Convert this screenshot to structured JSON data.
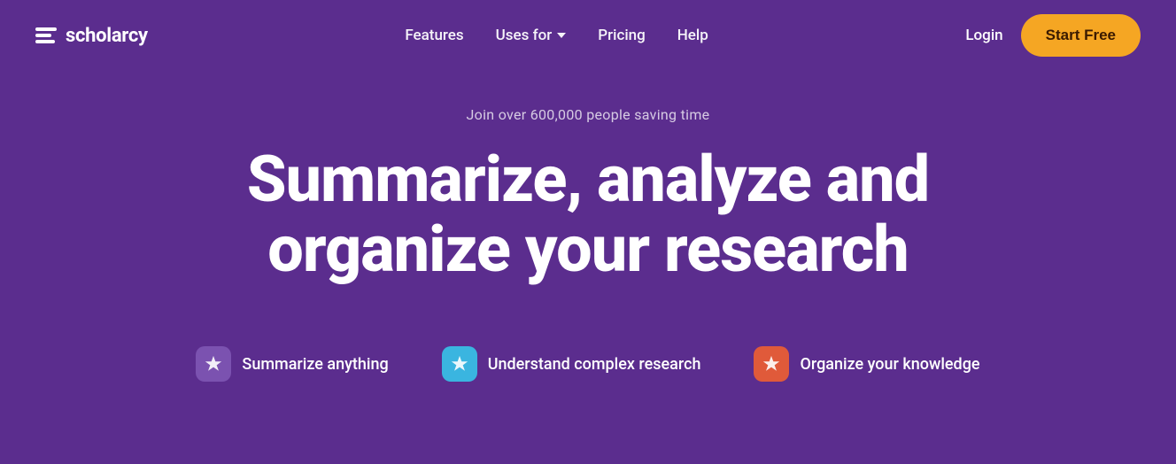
{
  "logo": {
    "text": "scholarcy"
  },
  "nav": {
    "links": [
      {
        "label": "Features",
        "id": "features"
      },
      {
        "label": "Uses for",
        "id": "uses-for",
        "hasDropdown": true
      },
      {
        "label": "Pricing",
        "id": "pricing"
      },
      {
        "label": "Help",
        "id": "help"
      }
    ],
    "login_label": "Login",
    "cta_label": "Start Free"
  },
  "hero": {
    "subtitle": "Join over 600,000 people saving time",
    "title_line1": "Summarize, analyze and",
    "title_line2": "organize your research"
  },
  "features": [
    {
      "id": "summarize",
      "label": "Summarize anything",
      "icon_color": "purple",
      "icon": "✦"
    },
    {
      "id": "understand",
      "label": "Understand complex research",
      "icon_color": "blue",
      "icon": "✦"
    },
    {
      "id": "organize",
      "label": "Organize your knowledge",
      "icon_color": "orange",
      "icon": "✦"
    }
  ],
  "colors": {
    "bg": "#5b2d8e",
    "cta_bg": "#f5a623",
    "pill_purple": "#7b52b0",
    "pill_blue": "#3ab5e0",
    "pill_orange": "#e05a3a"
  }
}
